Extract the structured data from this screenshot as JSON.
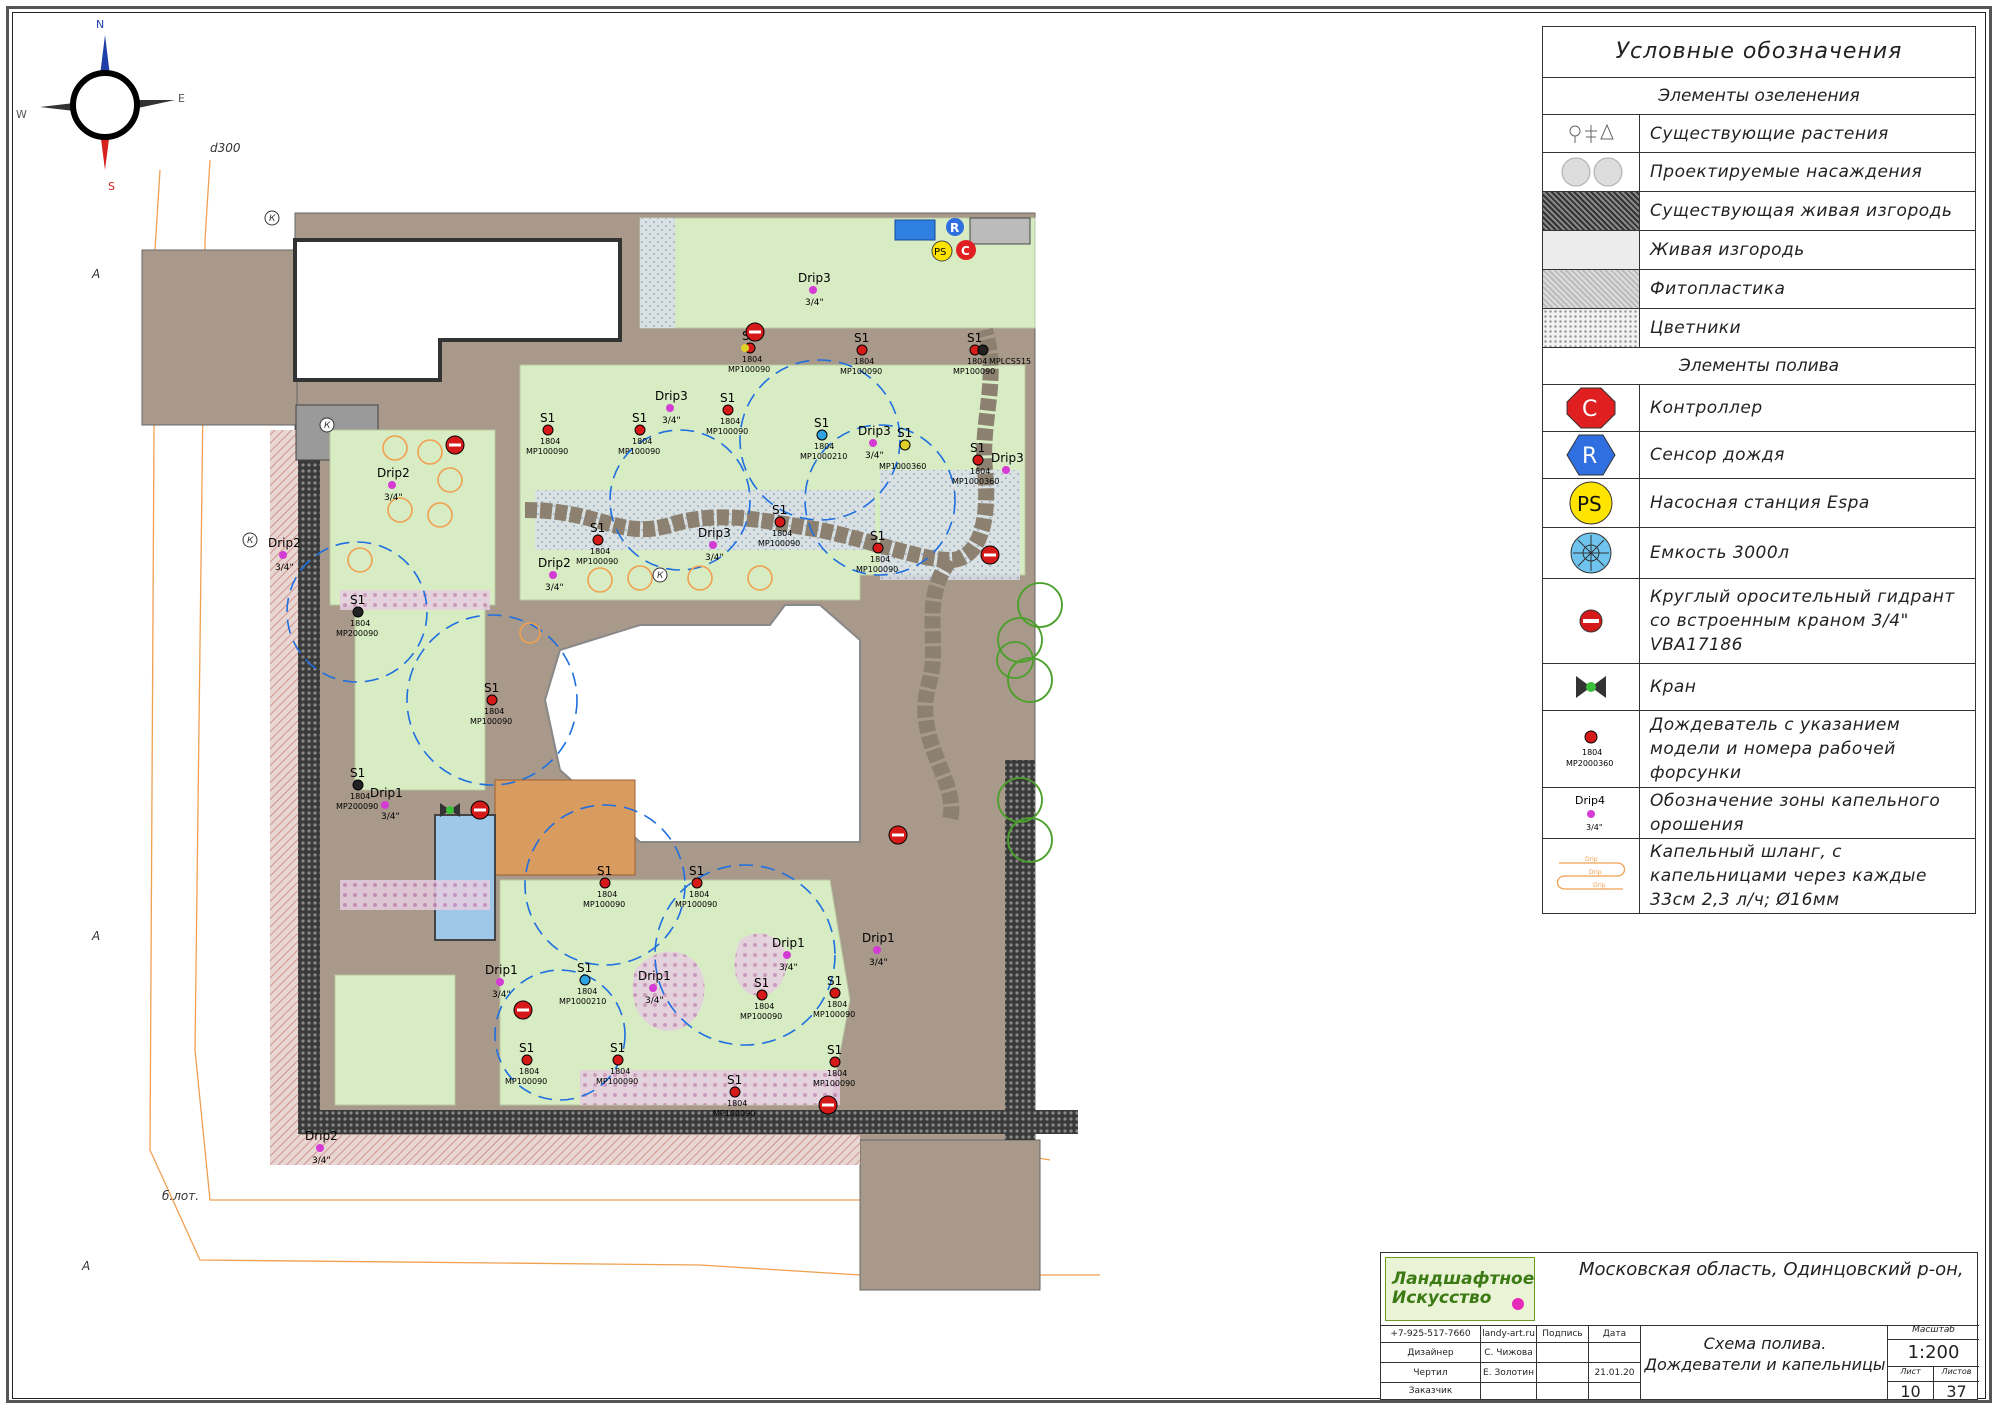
{
  "compass": {
    "n": "N",
    "e": "E",
    "s": "S",
    "w": "W"
  },
  "site_labels": {
    "pipe": "d300",
    "a1": "А",
    "a2": "А",
    "a3": "А",
    "lot": "б.лот.",
    "k": "К"
  },
  "zone_sprinkler": {
    "label": "S1",
    "model_top": "1804",
    "nozzle_a": "MP100090",
    "nozzle_b": "MP200090",
    "nozzle_c": "MP1000210",
    "nozzle_d": "MP1000360",
    "nozzle_e": "MPLCS515",
    "nozzle_f": "MP1000360"
  },
  "zone_drip": {
    "drip1": "Drip1",
    "drip2": "Drip2",
    "drip3": "Drip3",
    "size": "3/4\""
  },
  "equipment": {
    "r": "R",
    "c": "C",
    "ps": "PS"
  },
  "legend": {
    "title": "Условные обозначения",
    "section_green": "Элементы озеленения",
    "existing_plants": "Существующие растения",
    "planned_plants": "Проектируемые насаждения",
    "existing_hedge": "Существующая живая изгородь",
    "hedge": "Живая изгородь",
    "phytoplastic": "Фитопластика",
    "flowerbeds": "Цветники",
    "section_irrigation": "Элементы полива",
    "controller": "Контроллер",
    "rain_sensor": "Сенсор дождя",
    "pump": "Насосная станция Espa",
    "tank": "Емкость 3000л",
    "hydrant": "Круглый оросительный гидрант со встроенным краном 3/4\" VBA17186",
    "valve": "Кран",
    "sprinkler": "Дождеватель с указанием модели и номера рабочей форсунки",
    "drip_zone": "Обозначение зоны капельного орошения",
    "drip_hose": "Капельный шланг, с капельницами через каждые 33см 2,3 л/ч; Ø16мм",
    "sym_c": "C",
    "sym_r": "R",
    "sym_ps": "PS",
    "sym_model": "1804",
    "sym_nozzle": "MP2000360",
    "sym_drip": "Drip4",
    "sym_size": "3/4\"",
    "sym_hose": "Drip"
  },
  "title_block": {
    "logo_line1": "Ландшафтное",
    "logo_line2": "Искусство",
    "phone": "+7-925-517-7660",
    "site": "landy-art.ru",
    "address": "Московская область, Одинцовский р-он,",
    "h_sign": "Подпись",
    "h_date": "Дата",
    "r1_role": "Дизайнер",
    "r1_name": "С. Чижова",
    "r2_role": "Чертил",
    "r2_name": "Е. Золотин",
    "r2_date": "21.01.20",
    "r3_role": "Заказчик",
    "drawing_title": "Схема полива. Дождеватели и капельницы",
    "scale_h": "Масштаб",
    "scale": "1:200",
    "sheet_h": "Лист",
    "sheets_h": "Листов",
    "sheet": "10",
    "sheets": "37"
  }
}
